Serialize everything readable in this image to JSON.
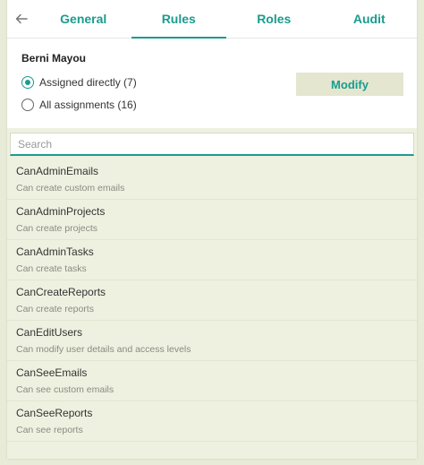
{
  "tabs": [
    {
      "label": "General",
      "active": false
    },
    {
      "label": "Rules",
      "active": true
    },
    {
      "label": "Roles",
      "active": false
    },
    {
      "label": "Audit",
      "active": false
    }
  ],
  "user": {
    "name": "Berni Mayou",
    "options": [
      {
        "label": "Assigned directly (7)",
        "checked": true
      },
      {
        "label": "All assignments (16)",
        "checked": false
      }
    ],
    "modify_label": "Modify"
  },
  "search": {
    "placeholder": "Search",
    "value": ""
  },
  "rules": [
    {
      "name": "CanAdminEmails",
      "desc": "Can create custom emails"
    },
    {
      "name": "CanAdminProjects",
      "desc": "Can create projects"
    },
    {
      "name": "CanAdminTasks",
      "desc": "Can create tasks"
    },
    {
      "name": "CanCreateReports",
      "desc": "Can create reports"
    },
    {
      "name": "CanEditUsers",
      "desc": "Can modify user details and access levels"
    },
    {
      "name": "CanSeeEmails",
      "desc": "Can see custom emails"
    },
    {
      "name": "CanSeeReports",
      "desc": "Can see reports"
    }
  ],
  "colors": {
    "accent": "#1a9c8e",
    "list_bg": "#eef1e0",
    "page_bg": "#e9ebd9"
  }
}
